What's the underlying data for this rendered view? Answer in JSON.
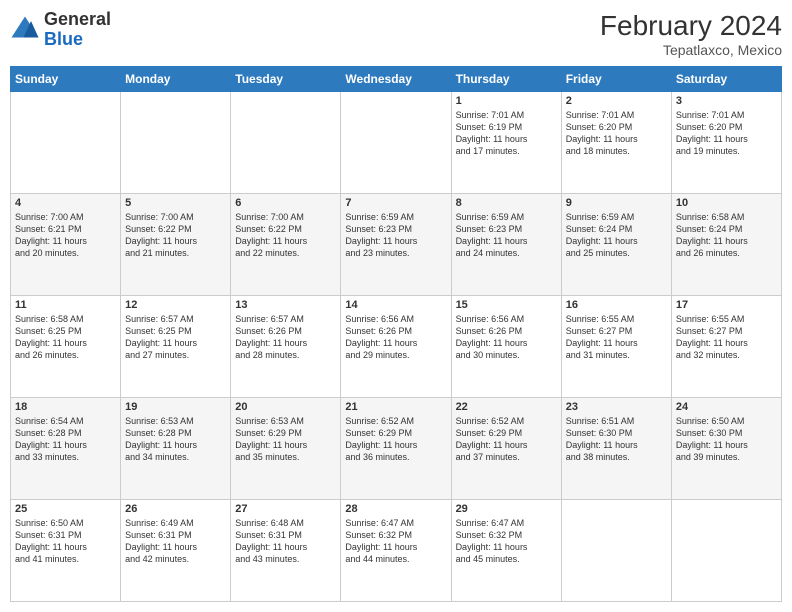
{
  "header": {
    "logo_general": "General",
    "logo_blue": "Blue",
    "month_year": "February 2024",
    "location": "Tepatlaxco, Mexico"
  },
  "days_of_week": [
    "Sunday",
    "Monday",
    "Tuesday",
    "Wednesday",
    "Thursday",
    "Friday",
    "Saturday"
  ],
  "weeks": [
    [
      {
        "day": "",
        "content": ""
      },
      {
        "day": "",
        "content": ""
      },
      {
        "day": "",
        "content": ""
      },
      {
        "day": "",
        "content": ""
      },
      {
        "day": "1",
        "content": "Sunrise: 7:01 AM\nSunset: 6:19 PM\nDaylight: 11 hours\nand 17 minutes."
      },
      {
        "day": "2",
        "content": "Sunrise: 7:01 AM\nSunset: 6:20 PM\nDaylight: 11 hours\nand 18 minutes."
      },
      {
        "day": "3",
        "content": "Sunrise: 7:01 AM\nSunset: 6:20 PM\nDaylight: 11 hours\nand 19 minutes."
      }
    ],
    [
      {
        "day": "4",
        "content": "Sunrise: 7:00 AM\nSunset: 6:21 PM\nDaylight: 11 hours\nand 20 minutes."
      },
      {
        "day": "5",
        "content": "Sunrise: 7:00 AM\nSunset: 6:22 PM\nDaylight: 11 hours\nand 21 minutes."
      },
      {
        "day": "6",
        "content": "Sunrise: 7:00 AM\nSunset: 6:22 PM\nDaylight: 11 hours\nand 22 minutes."
      },
      {
        "day": "7",
        "content": "Sunrise: 6:59 AM\nSunset: 6:23 PM\nDaylight: 11 hours\nand 23 minutes."
      },
      {
        "day": "8",
        "content": "Sunrise: 6:59 AM\nSunset: 6:23 PM\nDaylight: 11 hours\nand 24 minutes."
      },
      {
        "day": "9",
        "content": "Sunrise: 6:59 AM\nSunset: 6:24 PM\nDaylight: 11 hours\nand 25 minutes."
      },
      {
        "day": "10",
        "content": "Sunrise: 6:58 AM\nSunset: 6:24 PM\nDaylight: 11 hours\nand 26 minutes."
      }
    ],
    [
      {
        "day": "11",
        "content": "Sunrise: 6:58 AM\nSunset: 6:25 PM\nDaylight: 11 hours\nand 26 minutes."
      },
      {
        "day": "12",
        "content": "Sunrise: 6:57 AM\nSunset: 6:25 PM\nDaylight: 11 hours\nand 27 minutes."
      },
      {
        "day": "13",
        "content": "Sunrise: 6:57 AM\nSunset: 6:26 PM\nDaylight: 11 hours\nand 28 minutes."
      },
      {
        "day": "14",
        "content": "Sunrise: 6:56 AM\nSunset: 6:26 PM\nDaylight: 11 hours\nand 29 minutes."
      },
      {
        "day": "15",
        "content": "Sunrise: 6:56 AM\nSunset: 6:26 PM\nDaylight: 11 hours\nand 30 minutes."
      },
      {
        "day": "16",
        "content": "Sunrise: 6:55 AM\nSunset: 6:27 PM\nDaylight: 11 hours\nand 31 minutes."
      },
      {
        "day": "17",
        "content": "Sunrise: 6:55 AM\nSunset: 6:27 PM\nDaylight: 11 hours\nand 32 minutes."
      }
    ],
    [
      {
        "day": "18",
        "content": "Sunrise: 6:54 AM\nSunset: 6:28 PM\nDaylight: 11 hours\nand 33 minutes."
      },
      {
        "day": "19",
        "content": "Sunrise: 6:53 AM\nSunset: 6:28 PM\nDaylight: 11 hours\nand 34 minutes."
      },
      {
        "day": "20",
        "content": "Sunrise: 6:53 AM\nSunset: 6:29 PM\nDaylight: 11 hours\nand 35 minutes."
      },
      {
        "day": "21",
        "content": "Sunrise: 6:52 AM\nSunset: 6:29 PM\nDaylight: 11 hours\nand 36 minutes."
      },
      {
        "day": "22",
        "content": "Sunrise: 6:52 AM\nSunset: 6:29 PM\nDaylight: 11 hours\nand 37 minutes."
      },
      {
        "day": "23",
        "content": "Sunrise: 6:51 AM\nSunset: 6:30 PM\nDaylight: 11 hours\nand 38 minutes."
      },
      {
        "day": "24",
        "content": "Sunrise: 6:50 AM\nSunset: 6:30 PM\nDaylight: 11 hours\nand 39 minutes."
      }
    ],
    [
      {
        "day": "25",
        "content": "Sunrise: 6:50 AM\nSunset: 6:31 PM\nDaylight: 11 hours\nand 41 minutes."
      },
      {
        "day": "26",
        "content": "Sunrise: 6:49 AM\nSunset: 6:31 PM\nDaylight: 11 hours\nand 42 minutes."
      },
      {
        "day": "27",
        "content": "Sunrise: 6:48 AM\nSunset: 6:31 PM\nDaylight: 11 hours\nand 43 minutes."
      },
      {
        "day": "28",
        "content": "Sunrise: 6:47 AM\nSunset: 6:32 PM\nDaylight: 11 hours\nand 44 minutes."
      },
      {
        "day": "29",
        "content": "Sunrise: 6:47 AM\nSunset: 6:32 PM\nDaylight: 11 hours\nand 45 minutes."
      },
      {
        "day": "",
        "content": ""
      },
      {
        "day": "",
        "content": ""
      }
    ]
  ]
}
